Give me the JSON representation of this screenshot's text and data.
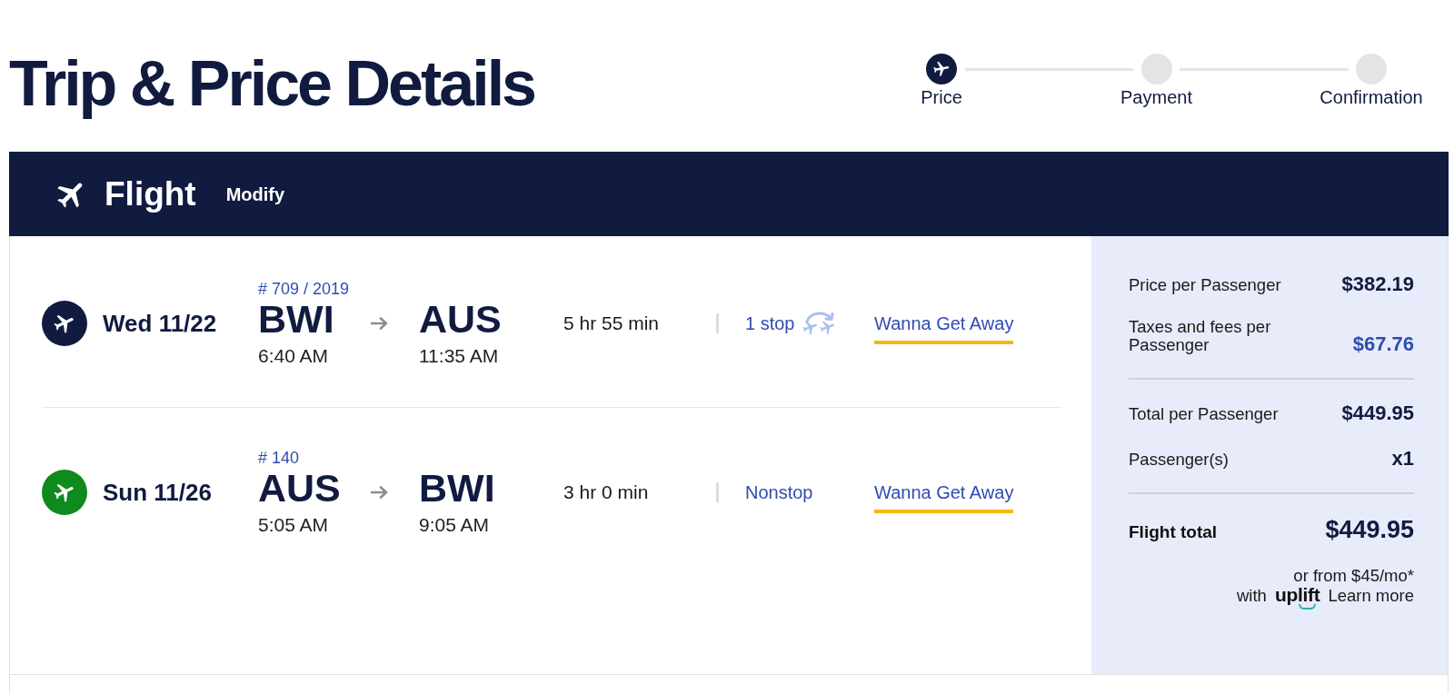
{
  "page": {
    "title": "Trip & Price Details"
  },
  "steps": [
    {
      "label": "Price",
      "selected": true
    },
    {
      "label": "Payment",
      "selected": false
    },
    {
      "label": "Confirmation",
      "selected": false
    }
  ],
  "section": {
    "title": "Flight",
    "action": "Modify"
  },
  "flights": [
    {
      "color": "#111b40",
      "date": "Wed 11/22",
      "flight_number": "# 709 / 2019",
      "origin": {
        "code": "BWI",
        "time": "6:40 AM"
      },
      "destination": {
        "code": "AUS",
        "time": "11:35 AM"
      },
      "duration": "5 hr 55 min",
      "stops": "1 stop",
      "stop_icon": true,
      "fare": "Wanna Get Away"
    },
    {
      "color": "#0f8a1d",
      "date": "Sun 11/26",
      "flight_number": "# 140",
      "origin": {
        "code": "AUS",
        "time": "5:05 AM"
      },
      "destination": {
        "code": "BWI",
        "time": "9:05 AM"
      },
      "duration": "3 hr 0 min",
      "stops": "Nonstop",
      "stop_icon": false,
      "fare": "Wanna Get Away"
    }
  ],
  "price_summary": {
    "groups": [
      {
        "rows": [
          {
            "label": "Price per Passenger",
            "value": "$382.19",
            "link": false
          },
          {
            "label": "Taxes and fees per Passenger",
            "value": "$67.76",
            "link": true
          }
        ]
      },
      {
        "rows": [
          {
            "label": "Total per Passenger",
            "value": "$449.95",
            "link": false
          },
          {
            "label": "Passenger(s)",
            "value": "x1",
            "link": false
          }
        ]
      }
    ],
    "total": {
      "label": "Flight total",
      "value": "$449.95"
    },
    "financing": {
      "offer": "or from $45/mo*",
      "with": "with",
      "provider": "uplift",
      "link": "Learn more"
    }
  }
}
